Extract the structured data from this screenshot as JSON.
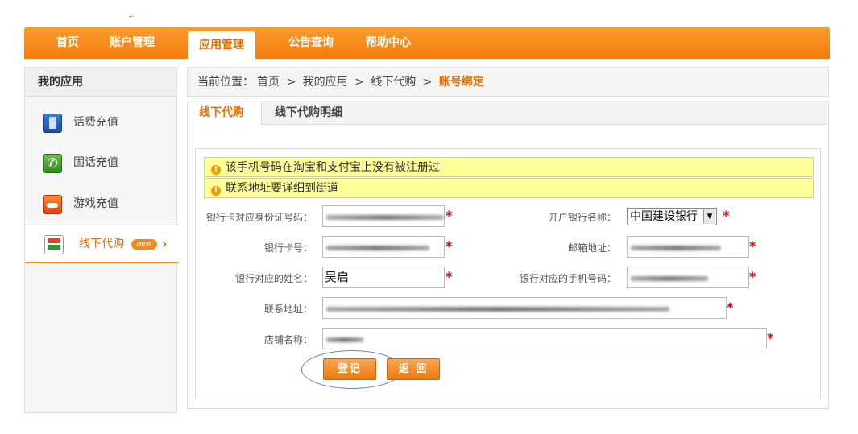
{
  "nav": {
    "items": [
      "首页",
      "账户管理",
      "应用管理",
      "公告查询",
      "帮助中心"
    ],
    "active": "应用管理"
  },
  "sidebar": {
    "title": "我的应用",
    "items": [
      {
        "label": "话费充值",
        "icon": "mobile-phone-icon"
      },
      {
        "label": "固话充值",
        "icon": "telephone-icon"
      },
      {
        "label": "游戏充值",
        "icon": "game-controller-icon"
      },
      {
        "label": "线下代购",
        "icon": "shopping-cart-icon",
        "badge": "new",
        "active": true
      }
    ]
  },
  "breadcrumb": {
    "prefix": "当前位置：",
    "items": [
      "首页",
      "我的应用",
      "线下代购"
    ],
    "separator": ">",
    "current": "账号绑定"
  },
  "tabs": [
    "线下代购",
    "线下代购明细"
  ],
  "notices": [
    "该手机号码在淘宝和支付宝上没有被注册过",
    "联系地址要详细到街道"
  ],
  "form": {
    "id_label": "银行卡对应身份证号码：",
    "bank_label": "开户银行名称：",
    "bank_value": "中国建设银行",
    "card_label": "银行卡号：",
    "email_label": "邮箱地址：",
    "name_label": "银行对应的姓名：",
    "name_value": "吴启",
    "phone_label": "银行对应的手机号码：",
    "address_label": "联系地址：",
    "shop_label": "店铺名称：",
    "required_mark": "*"
  },
  "buttons": {
    "register": "登记",
    "back": "返 回"
  },
  "colors": {
    "accent": "#f08a1a",
    "active_text": "#e76b00",
    "notice_bg": "#ffff99",
    "required": "#dd0000"
  }
}
